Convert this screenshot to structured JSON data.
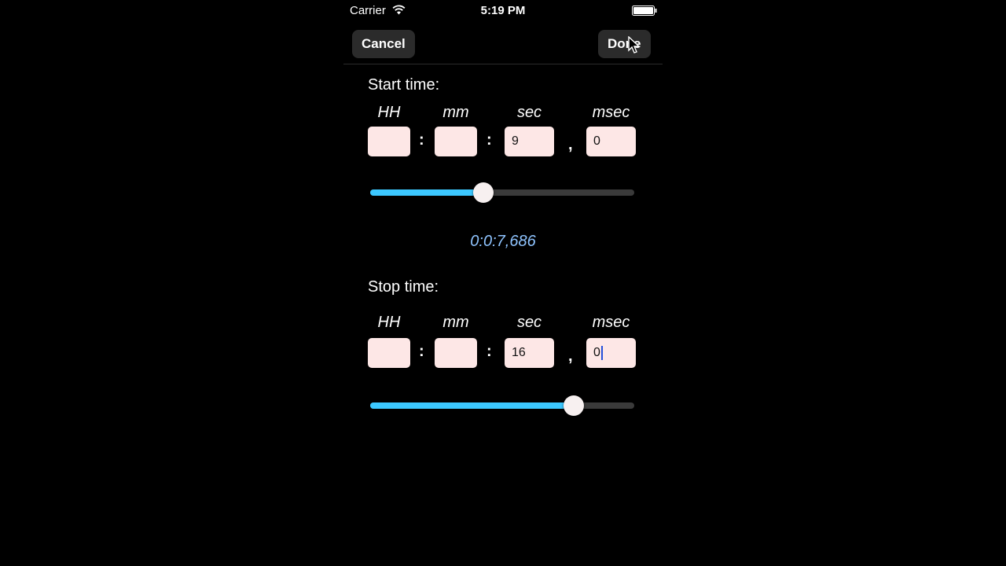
{
  "status_bar": {
    "carrier": "Carrier",
    "time": "5:19 PM"
  },
  "nav": {
    "cancel_label": "Cancel",
    "done_label": "Done"
  },
  "start": {
    "label": "Start time:",
    "headers": [
      "HH",
      "mm",
      "sec",
      "msec"
    ],
    "hh": "",
    "mm": "",
    "sec": "9",
    "msec": "0",
    "slider_fraction": 0.43
  },
  "readout": "0:0:7,686",
  "stop": {
    "label": "Stop time:",
    "headers": [
      "HH",
      "mm",
      "sec",
      "msec"
    ],
    "hh": "",
    "mm": "",
    "sec": "16",
    "msec": "0",
    "slider_fraction": 0.77
  },
  "separators": {
    "colon": ":",
    "comma": ","
  },
  "colors": {
    "slider_fill": "#3cc8ff",
    "field_bg": "#fde7e6",
    "readout": "#8fc4ff"
  }
}
